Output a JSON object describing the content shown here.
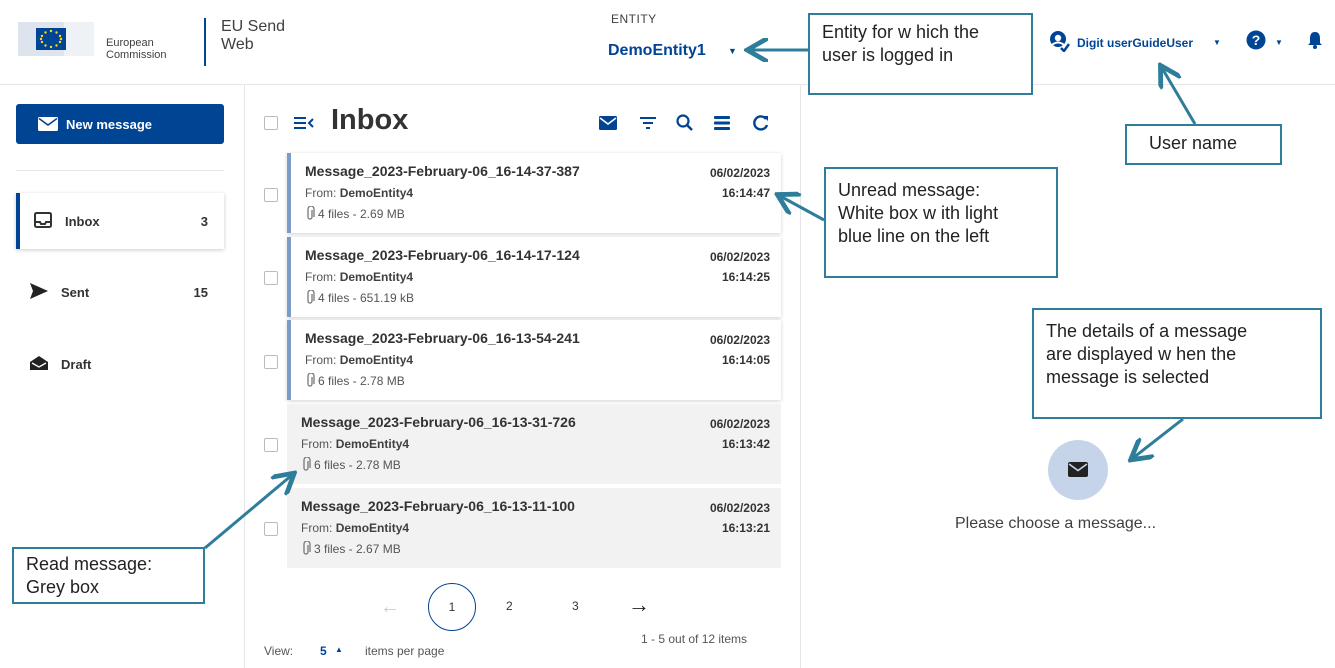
{
  "header": {
    "org_line1": "European",
    "org_line2": "Commission",
    "app_title_line1": "EU Send",
    "app_title_line2": "Web",
    "entity_label": "ENTITY",
    "entity_value": "DemoEntity1",
    "user_name": "Digit userGuideUser"
  },
  "sidebar": {
    "new_message_label": "New message",
    "items": [
      {
        "label": "Inbox",
        "count": "3"
      },
      {
        "label": "Sent",
        "count": "15"
      },
      {
        "label": "Draft",
        "count": ""
      }
    ]
  },
  "inbox": {
    "title": "Inbox",
    "messages": [
      {
        "subject": "Message_2023-February-06_16-14-37-387",
        "from_label": "From:",
        "from": "DemoEntity4",
        "files": "4 files - 2.69 MB",
        "date": "06/02/2023",
        "time": "16:14:47",
        "read": false
      },
      {
        "subject": "Message_2023-February-06_16-14-17-124",
        "from_label": "From:",
        "from": "DemoEntity4",
        "files": "4 files - 651.19 kB",
        "date": "06/02/2023",
        "time": "16:14:25",
        "read": false
      },
      {
        "subject": "Message_2023-February-06_16-13-54-241",
        "from_label": "From:",
        "from": "DemoEntity4",
        "files": "6 files - 2.78 MB",
        "date": "06/02/2023",
        "time": "16:14:05",
        "read": false
      },
      {
        "subject": "Message_2023-February-06_16-13-31-726",
        "from_label": "From:",
        "from": "DemoEntity4",
        "files": "6 files - 2.78 MB",
        "date": "06/02/2023",
        "time": "16:13:42",
        "read": true
      },
      {
        "subject": "Message_2023-February-06_16-13-11-100",
        "from_label": "From:",
        "from": "DemoEntity4",
        "files": "3 files - 2.67 MB",
        "date": "06/02/2023",
        "time": "16:13:21",
        "read": true
      }
    ],
    "pagination": {
      "prev": "←",
      "pages": [
        "1",
        "2",
        "3"
      ],
      "current": "1",
      "next": "→",
      "view_label": "View:",
      "view_value": "5",
      "items_per_page": "items per page",
      "count_text": "1 - 5 out of 12 items"
    }
  },
  "detail": {
    "empty_text": "Please choose a message..."
  },
  "annotations": {
    "entity": [
      "Entity  for w hich the",
      "user is logged in"
    ],
    "user": [
      "User name"
    ],
    "unread": [
      "Unread message:",
      "White box w ith light",
      "blue line on the left"
    ],
    "details": [
      "The details of a message",
      "are displayed w hen the",
      "message is selected"
    ],
    "read": [
      "Read message:",
      "Grey box"
    ]
  },
  "colors": {
    "primary": "#004494",
    "unread_bar": "#7b9cc9",
    "read_bg": "#f2f2f2",
    "callout_border": "#2e7d9a"
  }
}
